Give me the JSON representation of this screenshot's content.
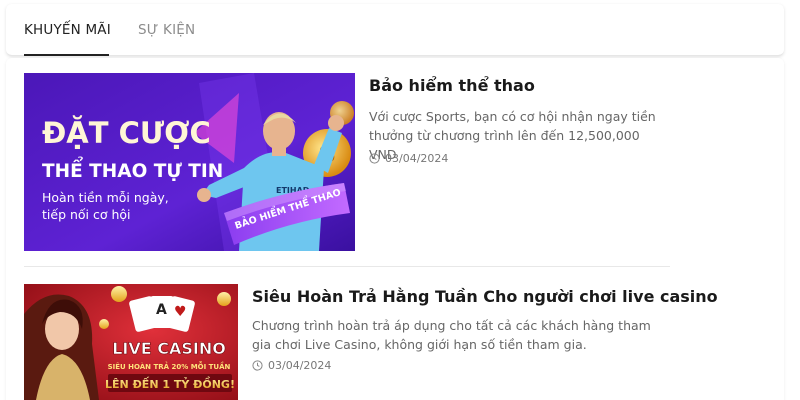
{
  "tabs": [
    {
      "label": "KHUYẾN MÃI",
      "active": true
    },
    {
      "label": "SỰ KIỆN",
      "active": false
    }
  ],
  "articles": [
    {
      "title": "Bảo hiểm thể thao",
      "description": "Với cược Sports, bạn có cơ hội nhận ngay tiền thưởng từ chương trình lên đến 12,500,000 VND",
      "date": "03/04/2024",
      "banner": {
        "headline_line1": "ĐẶT CƯỢC",
        "headline_line2": "THỂ THAO TỰ TIN",
        "subline1": "Hoàn tiền mỗi ngày,",
        "subline2": "tiếp nối cơ hội",
        "ribbon": "BẢO HIỂM THỂ THAO",
        "jersey": "ETIHAD",
        "background_color": "#5a1fc9"
      }
    },
    {
      "title": "Siêu Hoàn Trả Hằng Tuần Cho người chơi live casino",
      "description": "Chương trình hoàn trả áp dụng cho tất cả các khách hàng tham gia chơi Live Casino, không giới hạn số tiền tham gia.",
      "date": "03/04/2024",
      "banner": {
        "headline": "LIVE CASINO",
        "subline": "SIÊU HOÀN TRẢ 20% MỖI TUẦN",
        "amount": "LÊN ĐẾN 1 TỶ ĐỒNG!",
        "background_color": "#b3141d"
      }
    }
  ]
}
